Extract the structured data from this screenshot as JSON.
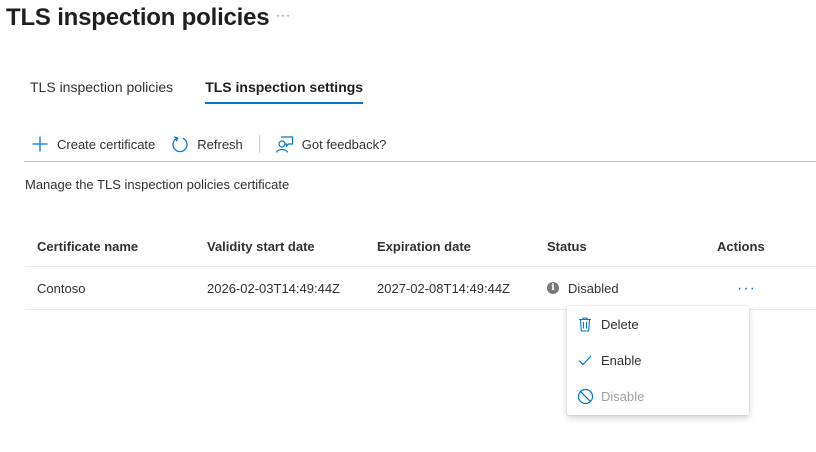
{
  "page": {
    "title": "TLS inspection policies",
    "more": "···"
  },
  "tabs": [
    {
      "label": "TLS inspection policies",
      "active": false
    },
    {
      "label": "TLS inspection settings",
      "active": true
    }
  ],
  "toolbar": {
    "create_label": "Create certificate",
    "refresh_label": "Refresh",
    "feedback_label": "Got feedback?"
  },
  "description": "Manage the TLS inspection policies certificate",
  "table": {
    "headers": [
      "Certificate name",
      "Validity start date",
      "Expiration date",
      "Status",
      "Actions"
    ],
    "rows": [
      {
        "name": "Contoso",
        "start": "2026-02-03T14:49:44Z",
        "expiration": "2027-02-08T14:49:44Z",
        "status": "Disabled",
        "actions": "···"
      }
    ]
  },
  "context_menu": {
    "items": [
      {
        "label": "Delete",
        "icon": "trash-icon",
        "enabled": true
      },
      {
        "label": "Enable",
        "icon": "checkmark-icon",
        "enabled": true
      },
      {
        "label": "Disable",
        "icon": "blocked-icon",
        "enabled": false
      }
    ]
  },
  "colors": {
    "accent": "#0078d4",
    "text": "#323130",
    "disabled": "#a19f9d"
  }
}
